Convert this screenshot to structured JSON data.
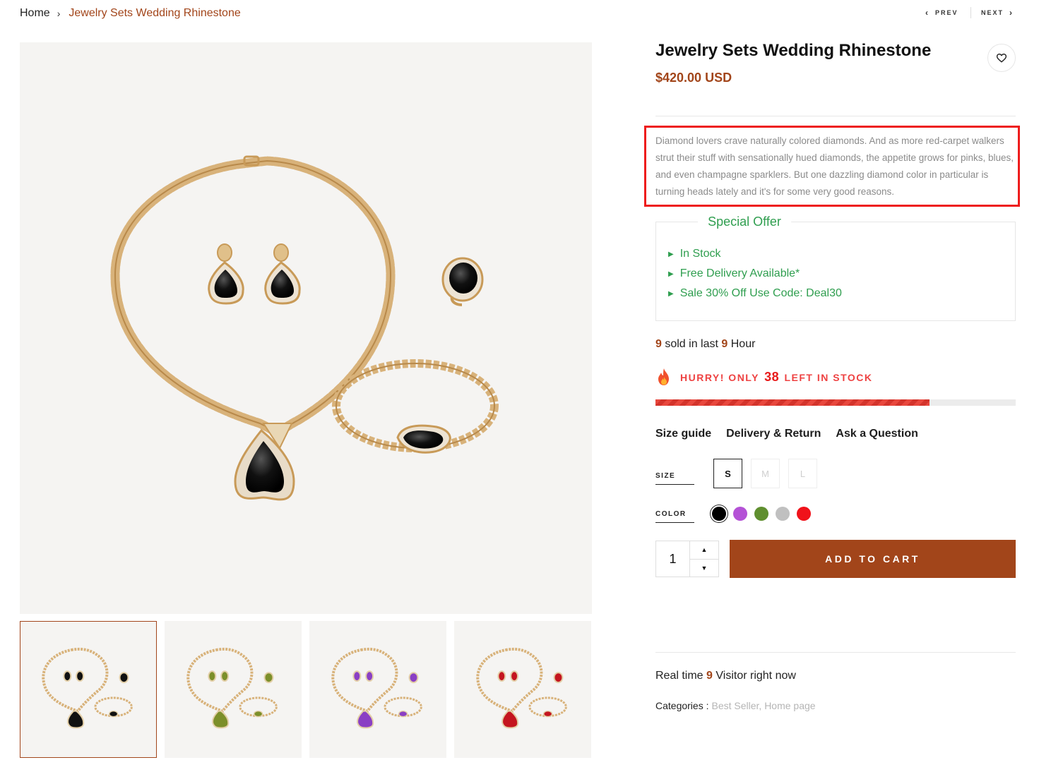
{
  "breadcrumb": {
    "home": "Home",
    "current": "Jewelry Sets Wedding Rhinestone"
  },
  "pager": {
    "prev": "PREV",
    "next": "NEXT"
  },
  "product": {
    "title": "Jewelry Sets Wedding Rhinestone",
    "price": "$420.00 USD",
    "description": "Diamond lovers crave naturally colored diamonds. And as more red-carpet walkers strut their stuff with sensationally hued diamonds, the appetite grows for pinks, blues, and even champagne sparklers. But one dazzling diamond color in particular is turning heads lately and it's for some very good reasons."
  },
  "special_offer": {
    "title": "Special Offer",
    "items": [
      "In Stock",
      "Free Delivery Available*",
      "Sale 30% Off Use Code: Deal30"
    ]
  },
  "sold": {
    "count": "9",
    "text_mid": " sold in last ",
    "hours": "9",
    "text_end": " Hour"
  },
  "stock": {
    "prefix": "HURRY! ONLY ",
    "count": "38",
    "suffix": " LEFT IN STOCK",
    "progress_fraction": 0.76
  },
  "links": [
    "Size guide",
    "Delivery & Return",
    "Ask a Question"
  ],
  "options": {
    "size_label": "SIZE",
    "sizes": [
      "S",
      "M",
      "L"
    ],
    "selected_size": "S",
    "color_label": "COLOR",
    "colors": [
      "#000000",
      "#b452d6",
      "#5f8f2f",
      "#c0c0c0",
      "#f0121a"
    ],
    "selected_color": "#000000"
  },
  "cart": {
    "quantity": "1",
    "add_label": "ADD TO CART"
  },
  "realtime": {
    "prefix": "Real time ",
    "count": "9",
    "suffix": " Visitor right now"
  },
  "categories": {
    "label": "Categories :",
    "value": "Best Seller, Home page"
  },
  "gallery": {
    "thumb_gem_colors": [
      "#111111",
      "#7c8f2a",
      "#8a3fc4",
      "#c4151f"
    ]
  },
  "theme": {
    "accent": "#a2451a",
    "offer_green": "#2f9e4f",
    "hurry_red": "#ee4242",
    "highlight_red": "#ee1c1c"
  }
}
